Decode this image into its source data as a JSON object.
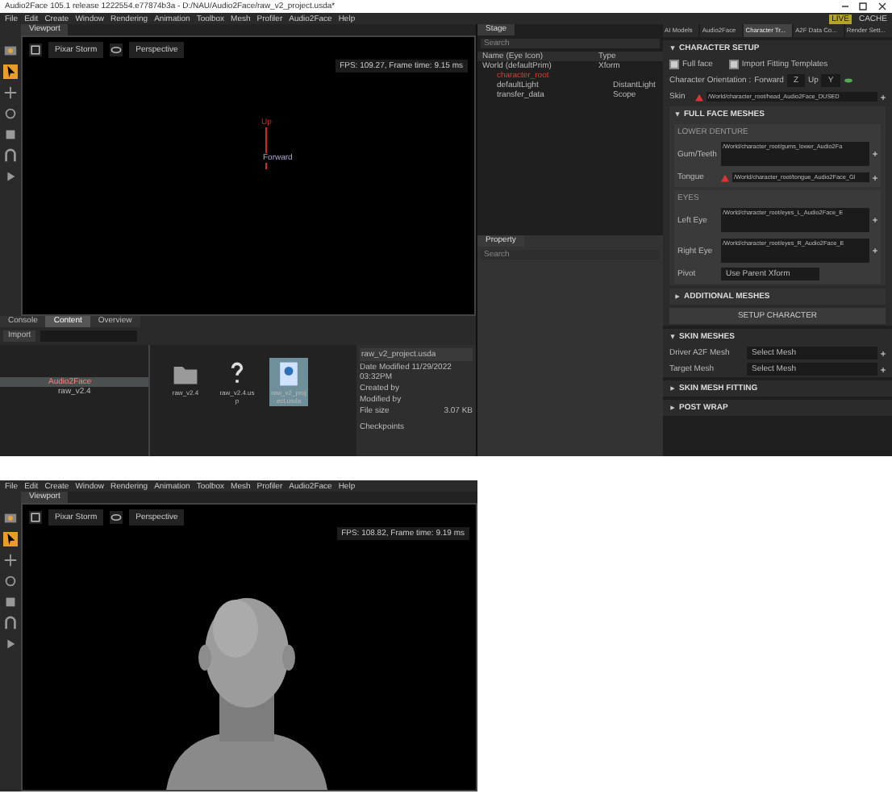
{
  "title_bar": {
    "title": "Audio2Face 105.1 release 1222554.e77874b3a - D:/NAU/Audio2Face/raw_v2_project.usda*"
  },
  "menu": [
    "File",
    "Edit",
    "Create",
    "Window",
    "Rendering",
    "Animation",
    "Toolbox",
    "Mesh",
    "Profiler",
    "Audio2Face",
    "Help"
  ],
  "status": {
    "live": "LIVE",
    "cache": "CACHE"
  },
  "viewport": {
    "tab": "Viewport",
    "buttons": [
      "Pixar Storm",
      "Perspective"
    ],
    "fps": "FPS: 109.27, Frame time: 9.15 ms",
    "axis_up": "Up",
    "axis_forward": "Forward"
  },
  "bottom_tabs": [
    {
      "label": "Console",
      "selected": false
    },
    {
      "label": "Content",
      "selected": true
    },
    {
      "label": "Overview",
      "selected": false
    }
  ],
  "content": {
    "import": "Import",
    "tree": [
      {
        "label": "Audio2Face",
        "selected": true,
        "children": [
          {
            "label": "raw_v2.4",
            "selected": false
          }
        ]
      }
    ],
    "files": [
      {
        "name": "raw_v2.4",
        "kind": "folder",
        "selected": false
      },
      {
        "name": "raw_v2.4.usp",
        "kind": "unknown",
        "selected": false
      },
      {
        "name": "raw_v2_project.usda",
        "kind": "usd",
        "selected": true
      }
    ],
    "info": {
      "file": "raw_v2_project.usda",
      "lines": [
        "Date Modified 11/29/2022 03:32PM",
        "Created by",
        "Modified by"
      ],
      "size_label": "File size",
      "size": "3.07 KB",
      "checkpoints": "Checkpoints"
    }
  },
  "stage": {
    "tab": "Stage",
    "search": "Search",
    "columns": [
      "Name (Eye Icon)",
      "Type"
    ],
    "rows": [
      {
        "name": "World (defaultPrim)",
        "type": "Xform",
        "selected": false,
        "children": [
          {
            "name": "character_root",
            "selected": true
          },
          {
            "name": "defaultLight",
            "type": "DistantLight",
            "selected": false
          },
          {
            "name": "transfer_data",
            "type": "Scope",
            "selected": false
          }
        ]
      }
    ]
  },
  "property": {
    "tab": "Property",
    "search": "Search"
  },
  "right_tabs": [
    {
      "label": "AI Models",
      "selected": false
    },
    {
      "label": "Audio2Face",
      "selected": false
    },
    {
      "label": "Character Tr...",
      "selected": true
    },
    {
      "label": "A2F Data Co...",
      "selected": false
    },
    {
      "label": "Render Sett...",
      "selected": false
    }
  ],
  "setup": {
    "title": "CHARACTER SETUP",
    "expanded": true,
    "checks": [
      {
        "label": "Full face",
        "checked": true
      },
      {
        "label": "Import Fitting Templates",
        "checked": true
      }
    ],
    "orientation": {
      "label": "Character Orientation :",
      "forward_label": "Forward",
      "forward": "Z",
      "up_label": "Up",
      "up": "Y"
    },
    "skin": {
      "label": "Skin",
      "path": "/World/character_root/head_Audio2Face_DUSED",
      "warning": true
    },
    "full_face": {
      "title": "FULL FACE MESHES",
      "expanded": true,
      "groups": [
        {
          "title": "LOWER DENTURE",
          "fields": [
            {
              "label": "Gum/Teeth",
              "path": "/World/character_root/gums_lower_Audio2Fa",
              "warning": false,
              "kind": "list"
            },
            {
              "label": "Tongue",
              "path": "/World/character_root/tongue_Audio2Face_Gl",
              "warning": true,
              "kind": "single"
            }
          ]
        },
        {
          "title": "EYES",
          "fields": [
            {
              "label": "Left Eye",
              "path": "/World/character_root/eyes_L_Audio2Face_E",
              "warning": false,
              "kind": "list"
            },
            {
              "label": "Right Eye",
              "path": "/World/character_root/eyes_R_Audio2Face_E",
              "warning": false,
              "kind": "list"
            },
            {
              "label": "Pivot",
              "path": "Use Parent Xform",
              "warning": false,
              "kind": "dropdown"
            }
          ]
        }
      ]
    },
    "additional": {
      "title": "ADDITIONAL MESHES",
      "expanded": false
    },
    "button": "SETUP CHARACTER"
  },
  "sections": [
    {
      "title": "SKIN MESHES",
      "expanded": true,
      "fields": [
        {
          "label": "Driver A2F Mesh",
          "value": "Select Mesh"
        },
        {
          "label": "Target Mesh",
          "value": "Select Mesh"
        }
      ]
    },
    {
      "title": "SKIN MESH FITTING",
      "expanded": false
    },
    {
      "title": "POST WRAP",
      "expanded": false
    }
  ],
  "second": {
    "menu": [
      "File",
      "Edit",
      "Create",
      "Window",
      "Rendering",
      "Animation",
      "Toolbox",
      "Mesh",
      "Profiler",
      "Audio2Face",
      "Help"
    ],
    "tab": "Viewport",
    "buttons": [
      "Pixar Storm",
      "Perspective"
    ],
    "fps": "FPS: 108.82, Frame time: 9.19 ms",
    "scene": {
      "kind": "picture"
    }
  }
}
